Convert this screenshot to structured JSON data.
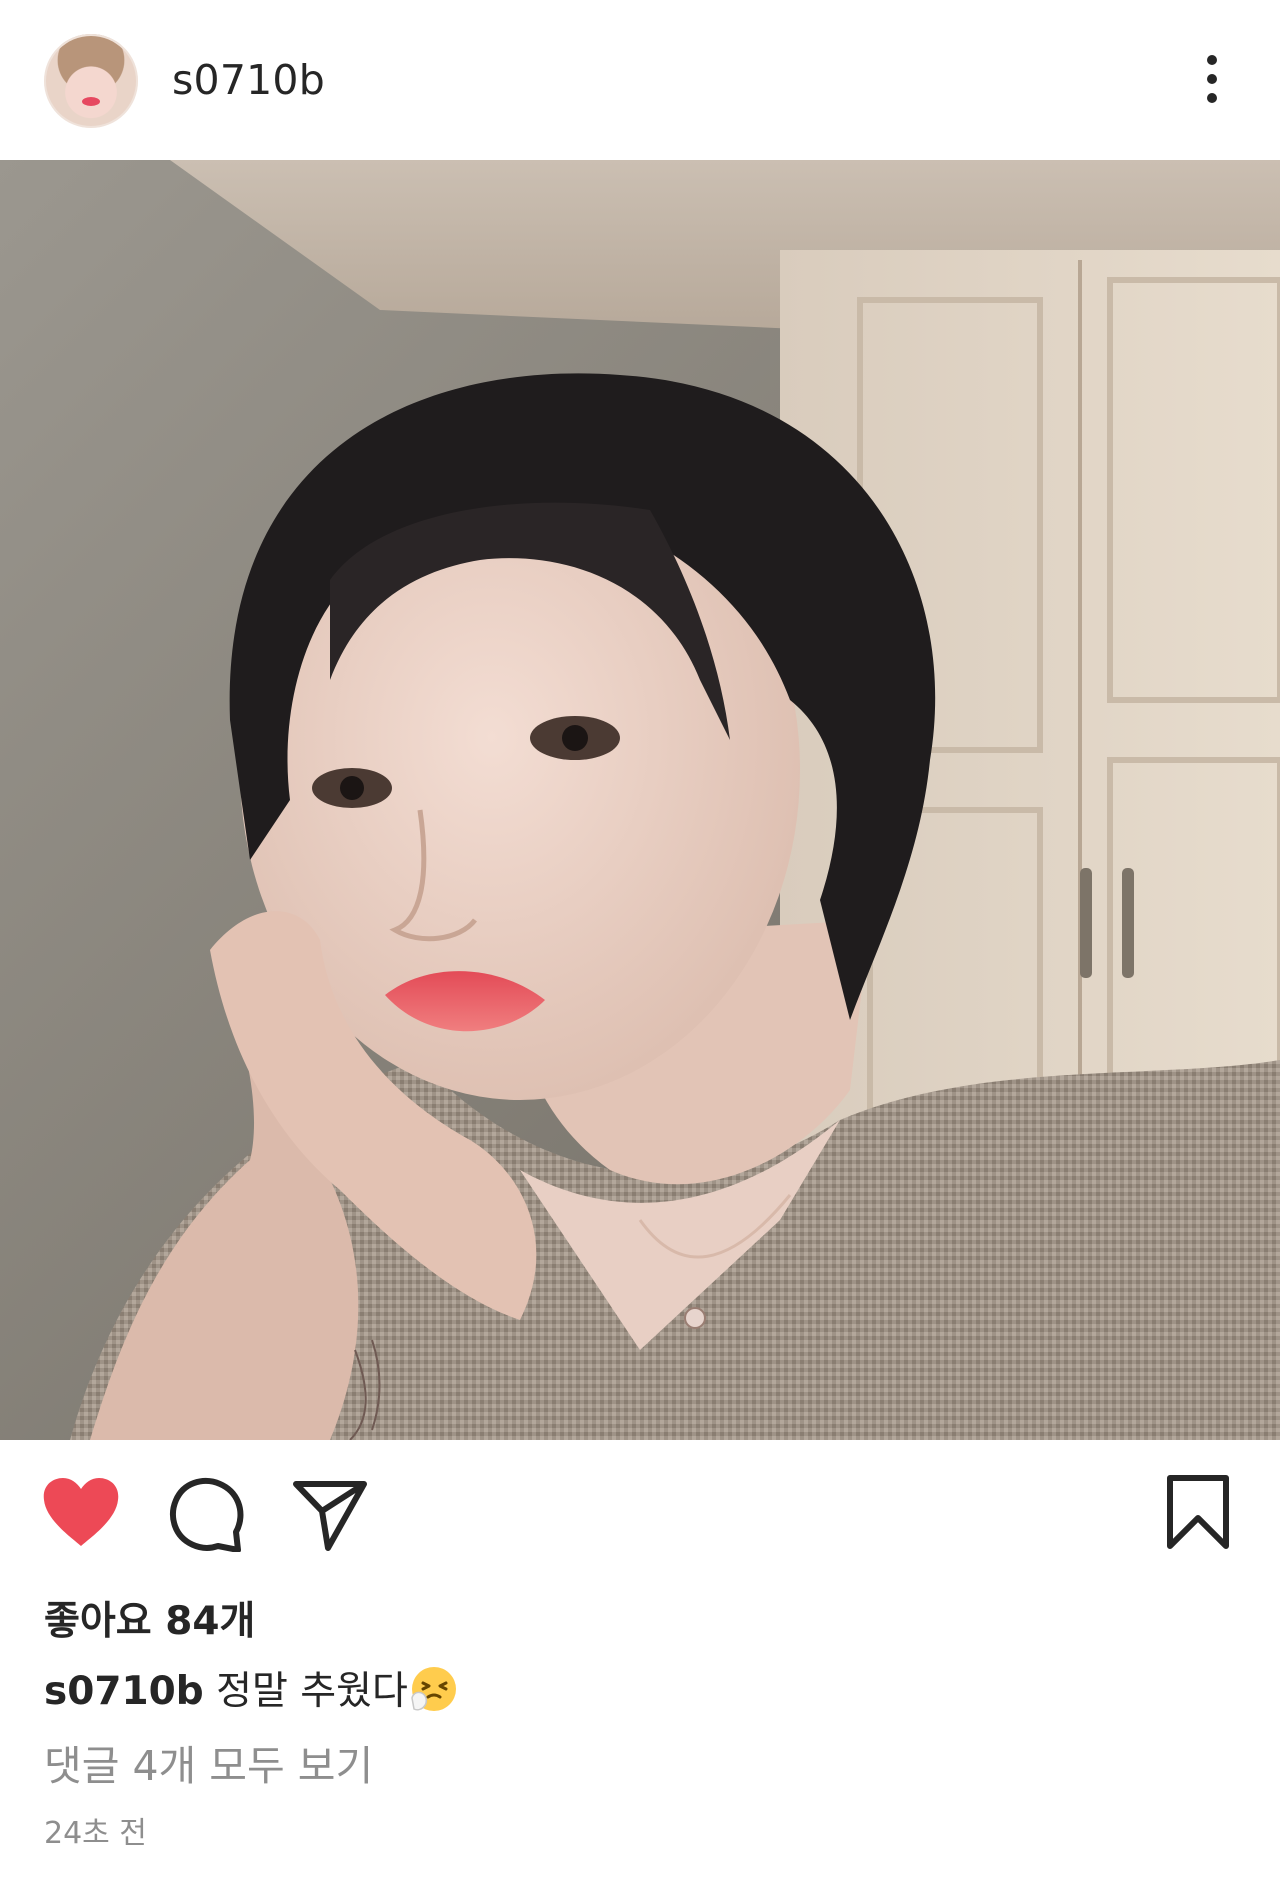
{
  "post": {
    "username": "s0710b",
    "likes_text": "좋아요 84개",
    "caption_user": "s0710b",
    "caption_text": "정말 추웠다",
    "caption_emoji": "sneezing-face-emoji",
    "view_comments_text": "댓글 4개 모두 보기",
    "timestamp": "24초 전",
    "liked": true
  },
  "icons": {
    "more": "more-vertical-icon",
    "like": "heart-icon",
    "comment": "comment-icon",
    "share": "send-icon",
    "save": "bookmark-icon"
  },
  "colors": {
    "like_active": "#ed4956",
    "text_primary": "#262626",
    "text_secondary": "#8e8e8e"
  }
}
